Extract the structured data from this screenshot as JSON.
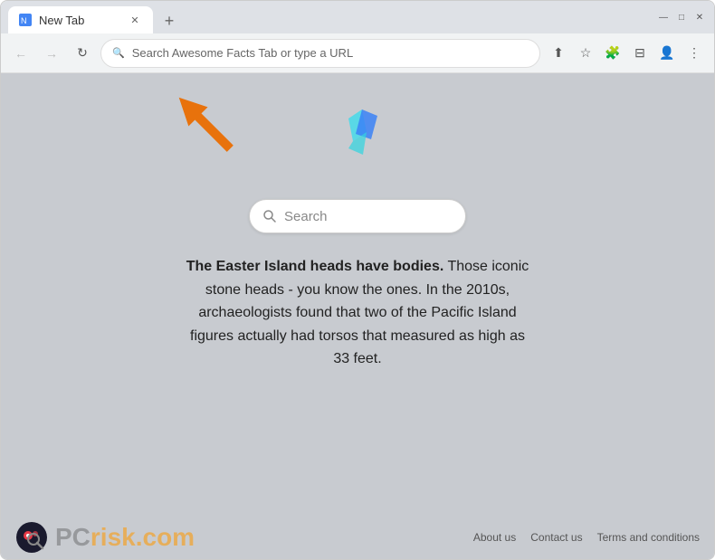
{
  "browser": {
    "tab": {
      "title": "New Tab",
      "favicon": "🔵"
    },
    "address_bar": {
      "placeholder": "Search Awesome Facts Tab or type a URL",
      "value": "Search Awesome Facts Tab or type a URL"
    }
  },
  "page": {
    "search_placeholder": "Search",
    "fact_bold": "The Easter Island heads have bodies.",
    "fact_text": " Those iconic stone heads - you know the ones. In the 2010s, archaeologists found that two of the Pacific Island figures actually had torsos that measured as high as 33 feet.",
    "footer": {
      "links": [
        {
          "label": "About us"
        },
        {
          "label": "Contact us"
        },
        {
          "label": "Terms and conditions"
        }
      ],
      "pcrisk_text": "risk.com",
      "pcrisk_prefix": "PC"
    }
  },
  "icons": {
    "back": "←",
    "forward": "→",
    "refresh": "↻",
    "search": "🔍",
    "share": "⬆",
    "bookmark": "☆",
    "extension": "🧩",
    "sidebar": "⊟",
    "profile": "👤",
    "menu": "⋮",
    "close": "✕",
    "minimize": "—",
    "maximize": "□",
    "window_close": "✕"
  }
}
